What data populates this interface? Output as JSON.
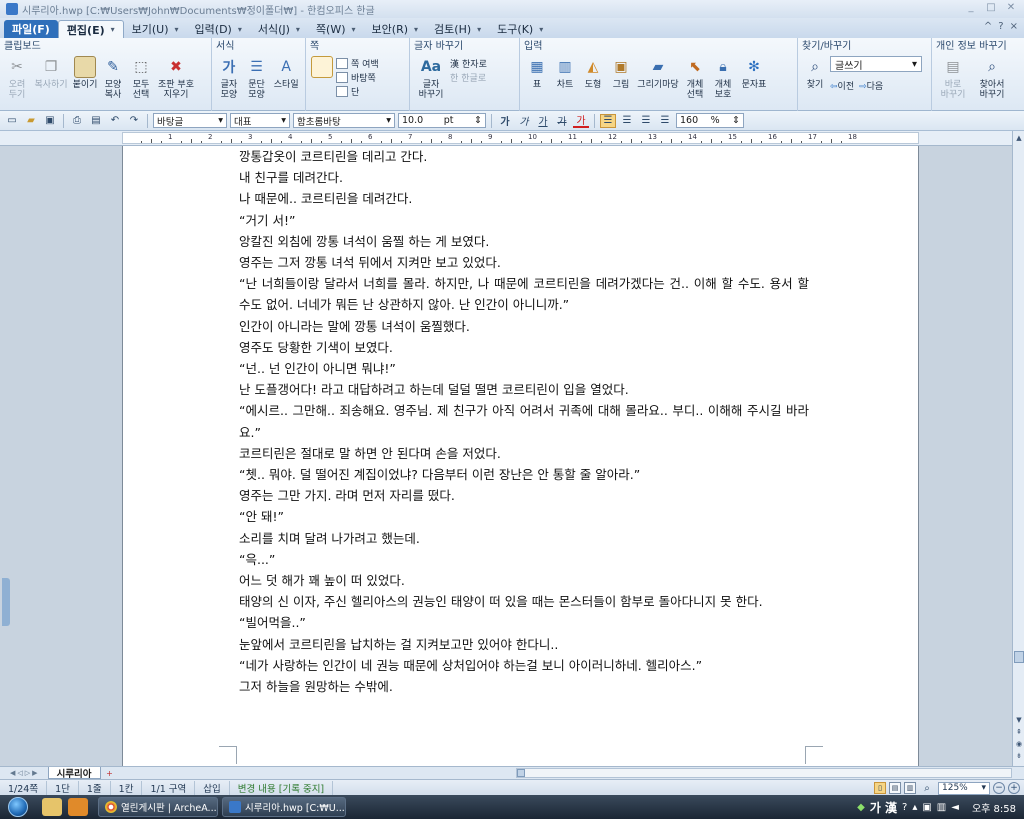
{
  "window": {
    "title": "시루리아.hwp [C:₩Users₩John₩Documents₩정이폴더₩] - 한컴오피스 한글",
    "controls": [
      "_",
      "□",
      "✕"
    ]
  },
  "menu": {
    "items": [
      {
        "label": "파일(F)"
      },
      {
        "label": "편집(E)"
      },
      {
        "label": "보기(U)"
      },
      {
        "label": "입력(D)"
      },
      {
        "label": "서식(J)"
      },
      {
        "label": "쪽(W)"
      },
      {
        "label": "보안(R)"
      },
      {
        "label": "검토(H)"
      },
      {
        "label": "도구(K)"
      }
    ],
    "right": [
      "^",
      "?",
      "×"
    ]
  },
  "ribbon": {
    "clipboard": {
      "title": "클립보드",
      "cut": "오려\n두기",
      "copy": "복사하기",
      "paste": "붙이기",
      "format_copy": "모양\n복사",
      "select_all": "모두\n선택",
      "clear_format": "조판 부호\n지우기"
    },
    "format": {
      "title": "서식",
      "char_shape": "글자\n모양",
      "para_shape": "문단\n모양",
      "style": "스타일"
    },
    "page": {
      "title": "쪽",
      "margin": "쪽 여백",
      "background": "바탕쪽",
      "column": "단"
    },
    "char_convert": {
      "title": "글자 바꾸기",
      "hanja": "한자로",
      "hangul": "한글로",
      "convert": "글자\n바꾸기"
    },
    "insert": {
      "title": "입력",
      "table": "표",
      "chart": "차트",
      "shape": "도형",
      "picture": "그림",
      "drawing": "그리기마당",
      "object_select": "개체\n선택",
      "object_protect": "개체\n보호",
      "symbol": "문자표"
    },
    "find": {
      "title": "찾기/바꾸기",
      "find": "찾기",
      "combo": "글쓰기",
      "prev": "이전",
      "next": "다음"
    },
    "personal": {
      "title": "개인 정보 바꾸기",
      "change": "바로\n바꾸기",
      "find_change": "찾아서\n바꾸기"
    }
  },
  "format_toolbar": {
    "style": "바탕글",
    "lang": "대표",
    "font": "함초롬바탕",
    "size": "10.0",
    "size_unit": "pt",
    "bold": "가",
    "italic": "가",
    "underline": "가",
    "strike": "가",
    "color": "가",
    "line_spacing": "160",
    "line_spacing_unit": "%"
  },
  "ruler": {
    "labels": [
      "1",
      "2",
      "3",
      "4",
      "5",
      "6",
      "7",
      "8",
      "9",
      "10",
      "11",
      "12",
      "13",
      "14",
      "15",
      "16",
      "17",
      "18"
    ]
  },
  "document": {
    "lines": [
      "깡통갑옷이 코르티린을 데리고 간다.",
      "내 친구를 데려간다.",
      "나 때문에.. 코르티린을 데려간다.",
      "“거기 서!”",
      "앙칼진 외침에 깡통 녀석이 움찔 하는 게 보였다.",
      "영주는 그저 깡통 녀석 뒤에서 지켜만 보고 있었다.",
      "“난 너희들이랑 달라서 너희를 몰라. 하지만, 나 때문에 코르티린을 데려가겠다는 건.. 이해 할 수도. 용서 할 수도 없어. 너네가 뭐든 난 상관하지 않아. 난 인간이 아니니까.”",
      "인간이 아니라는 말에 깡통 녀석이 움찔했다.",
      "영주도 당황한 기색이 보였다.",
      "“넌.. 넌 인간이 아니면 뭐냐!”",
      "난 도플갱어다! 라고 대답하려고 하는데 덜덜 떨면 코르티린이 입을 열었다.",
      "“에시르.. 그만해.. 죄송해요. 영주님. 제 친구가 아직 어려서 귀족에 대해 몰라요.. 부디.. 이해해 주시길 바라요.”",
      "코르티린은 절대로 말 하면 안 된다며 손을 저었다.",
      "“쳇.. 뭐야. 덜 떨어진 계집이었냐? 다음부터 이런 장난은 안 통할 줄 알아라.”",
      "영주는 그만 가지. 라며 먼저 자리를 떴다.",
      "“안 돼!”",
      "소리를 치며 달려 나가려고 했는데.",
      "“윽...”",
      "어느 덧 해가 꽤 높이 떠 있었다.",
      "태양의 신 이자, 주신 헬리아스의 권능인 태양이 떠 있을 때는 몬스터들이 함부로 돌아다니지 못 한다.",
      "“빌어먹을..”",
      "눈앞에서 코르티린을 납치하는 걸 지켜보고만 있어야 한다니..",
      "“네가 사랑하는 인간이 네 권능 때문에 상처입어야 하는걸 보니 아이러니하네. 헬리아스.”",
      "그저 하늘을 원망하는 수밖에."
    ]
  },
  "tabs": {
    "doc_tab": "시루리아",
    "add": "+"
  },
  "status": {
    "page": "1/24쪽",
    "section": "1단",
    "line": "1줄",
    "column": "1칸",
    "area": "1/1 구역",
    "mode": "삽입",
    "tracking": "변경 내용 [기록 중지]",
    "zoom": "125%"
  },
  "taskbar": {
    "tasks": [
      {
        "label": "열린게시판 | ArcheA..."
      },
      {
        "label": "시루리아.hwp [C:₩U..."
      }
    ],
    "ime": "가 漢",
    "clock": "오후 8:58"
  }
}
